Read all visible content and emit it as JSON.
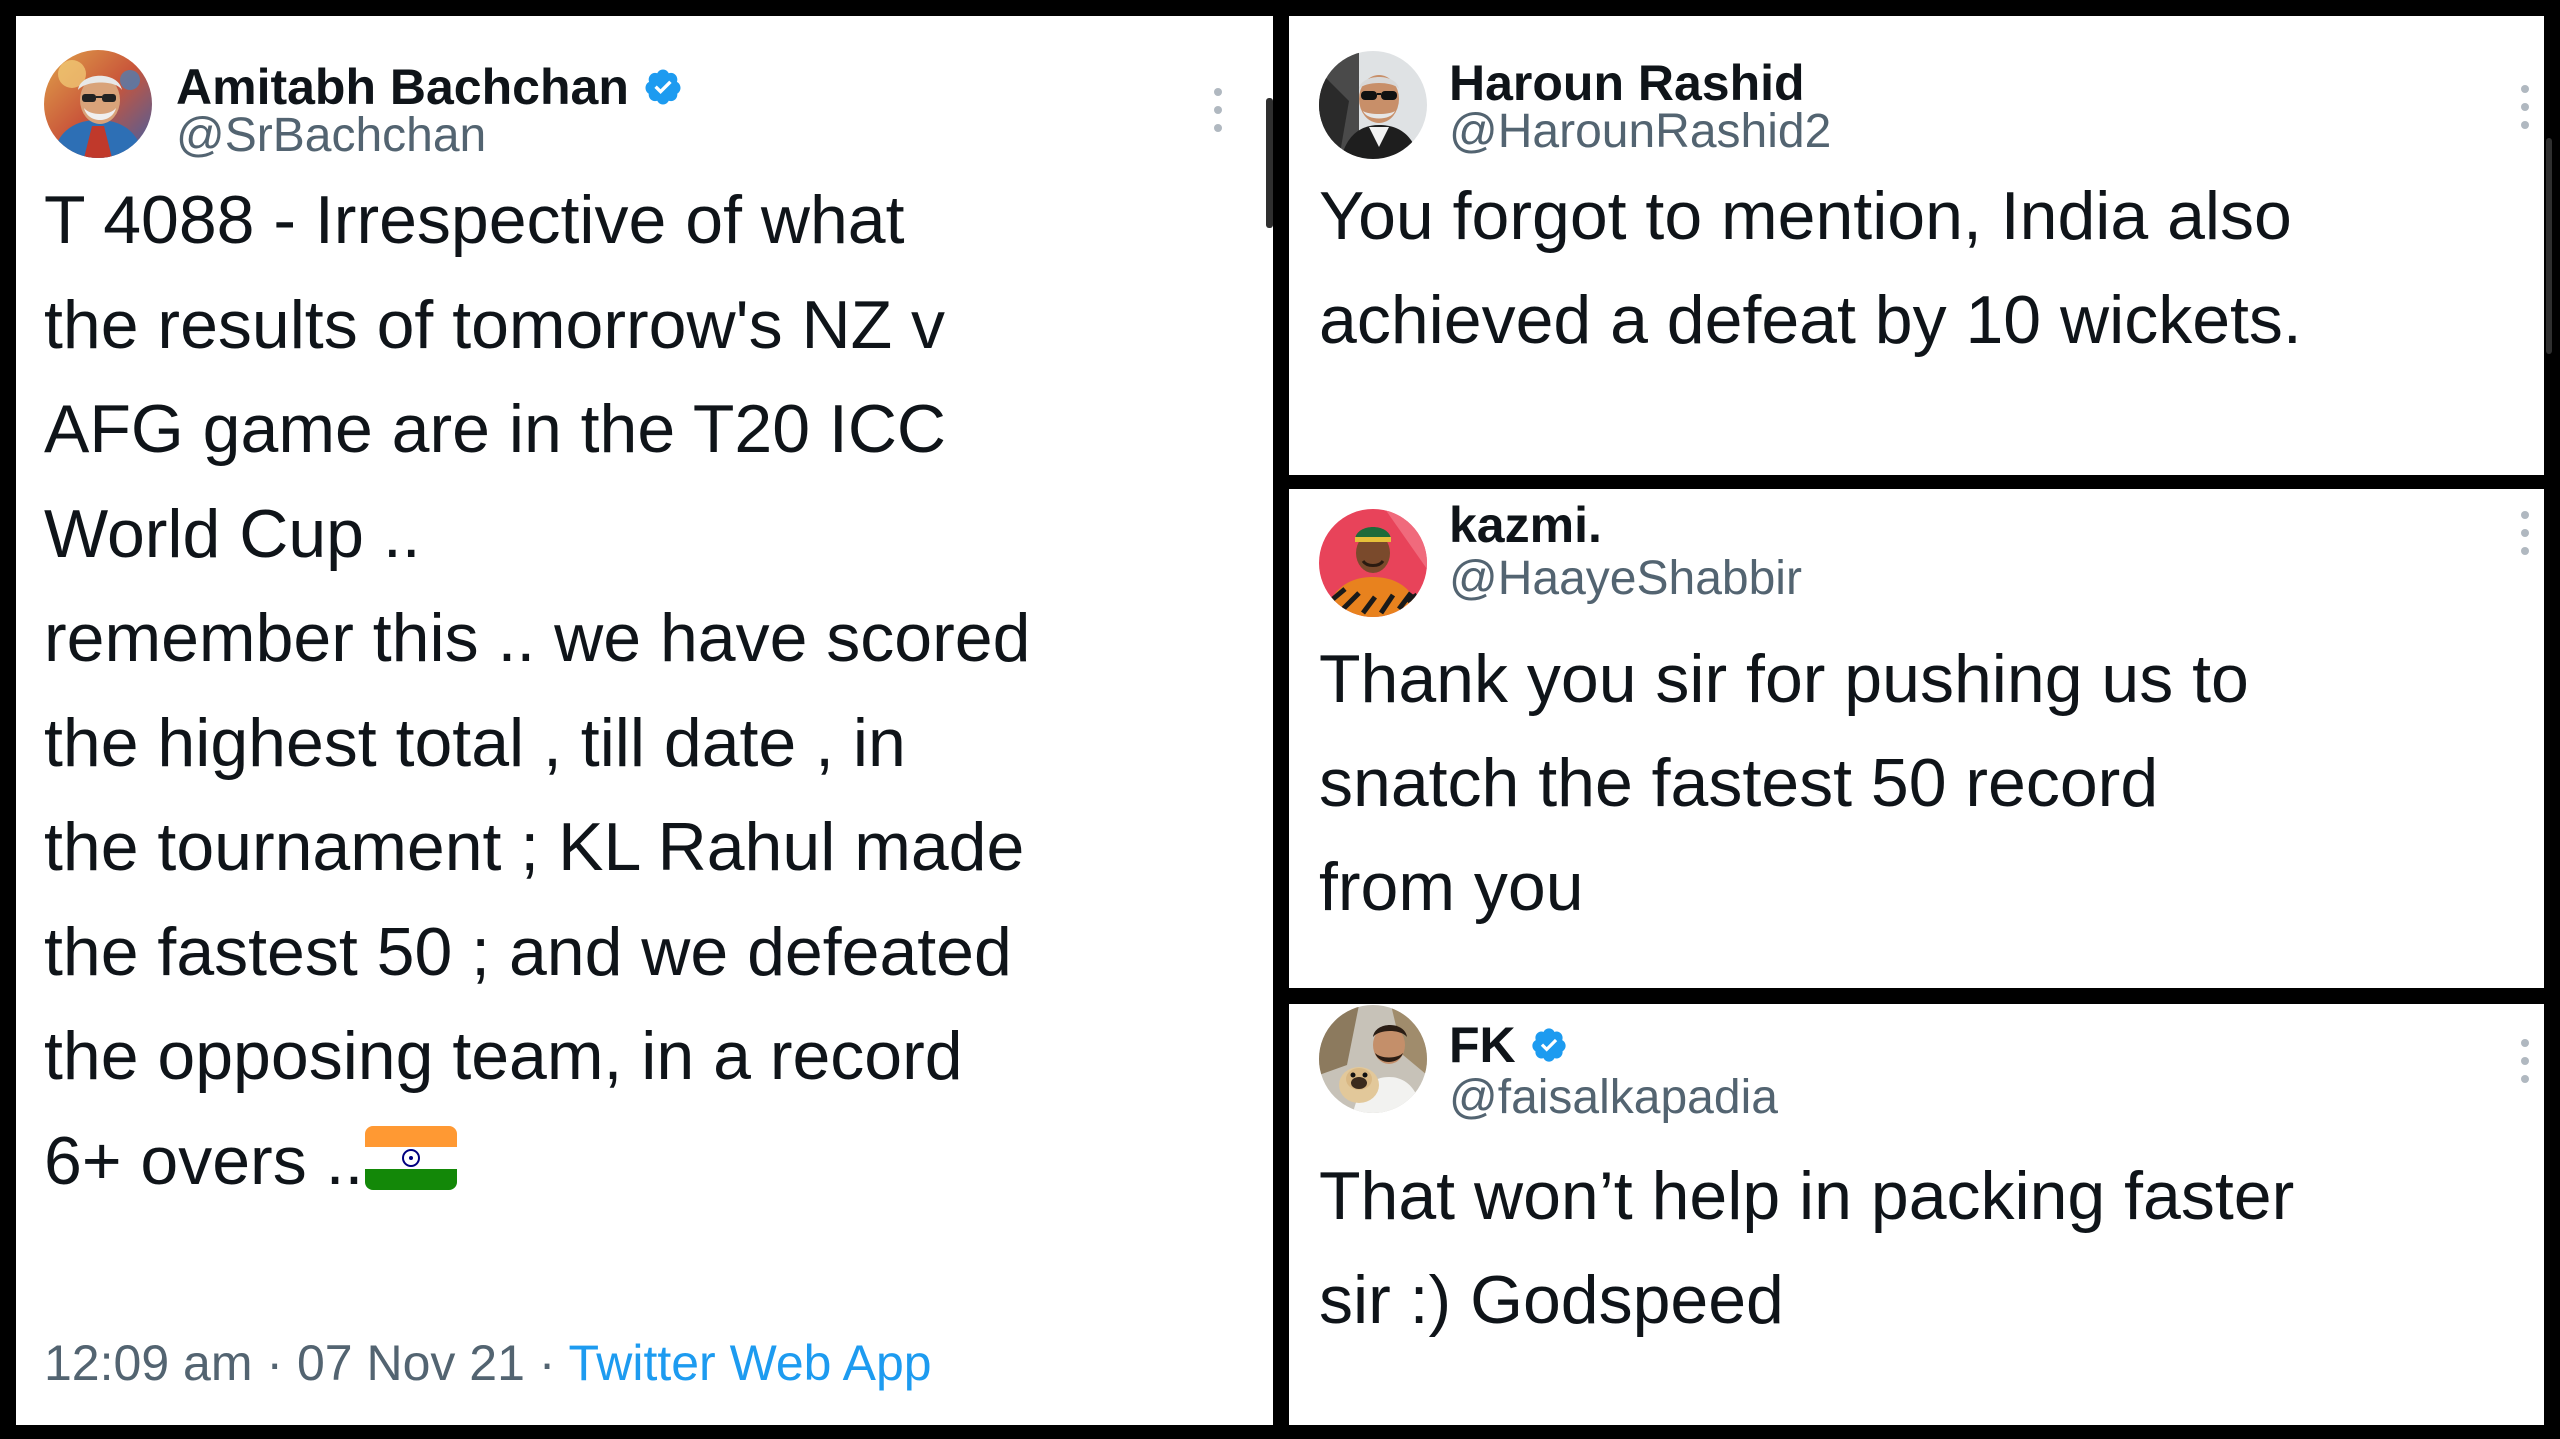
{
  "tweets": {
    "main": {
      "display_name": "Amitabh Bachchan",
      "verified": true,
      "handle": "@SrBachchan",
      "text": "T 4088 - Irrespective of what\nthe results of tomorrow's NZ v\nAFG game are in the T20 ICC\nWorld Cup ..\nremember this .. we have scored\nthe highest total , till date , in\nthe tournament ; KL Rahul made\nthe fastest 50 ; and we defeated\nthe opposing team, in a record\n6+ overs ..",
      "flag_icon": "india-flag-emoji",
      "time": "12:09 am",
      "separator": "·",
      "date": "07 Nov 21",
      "source": "Twitter Web App"
    },
    "reply_1": {
      "display_name": "Haroun Rashid",
      "verified": false,
      "handle": "@HarounRashid2",
      "text": "You forgot to mention, India also\nachieved a defeat by 10 wickets."
    },
    "reply_2": {
      "display_name": "kazmi.",
      "verified": false,
      "handle": "@HaayeShabbir",
      "text": "Thank you sir for pushing us to\nsnatch the fastest 50 record\nfrom you"
    },
    "reply_3": {
      "display_name": "FK",
      "verified": true,
      "handle": "@faisalkapadia",
      "text": "That won’t help in packing faster\nsir :) Godspeed"
    }
  },
  "colors": {
    "text_primary": "#0f1419",
    "text_secondary": "#536471",
    "link": "#1d9bf0",
    "verified_badge": "#1d9bf0",
    "divider": "#000000",
    "panel_background": "#ffffff"
  },
  "icons": {
    "verified": "verified-badge-icon",
    "more": "more-options-icon",
    "flag": "india-flag-emoji"
  }
}
